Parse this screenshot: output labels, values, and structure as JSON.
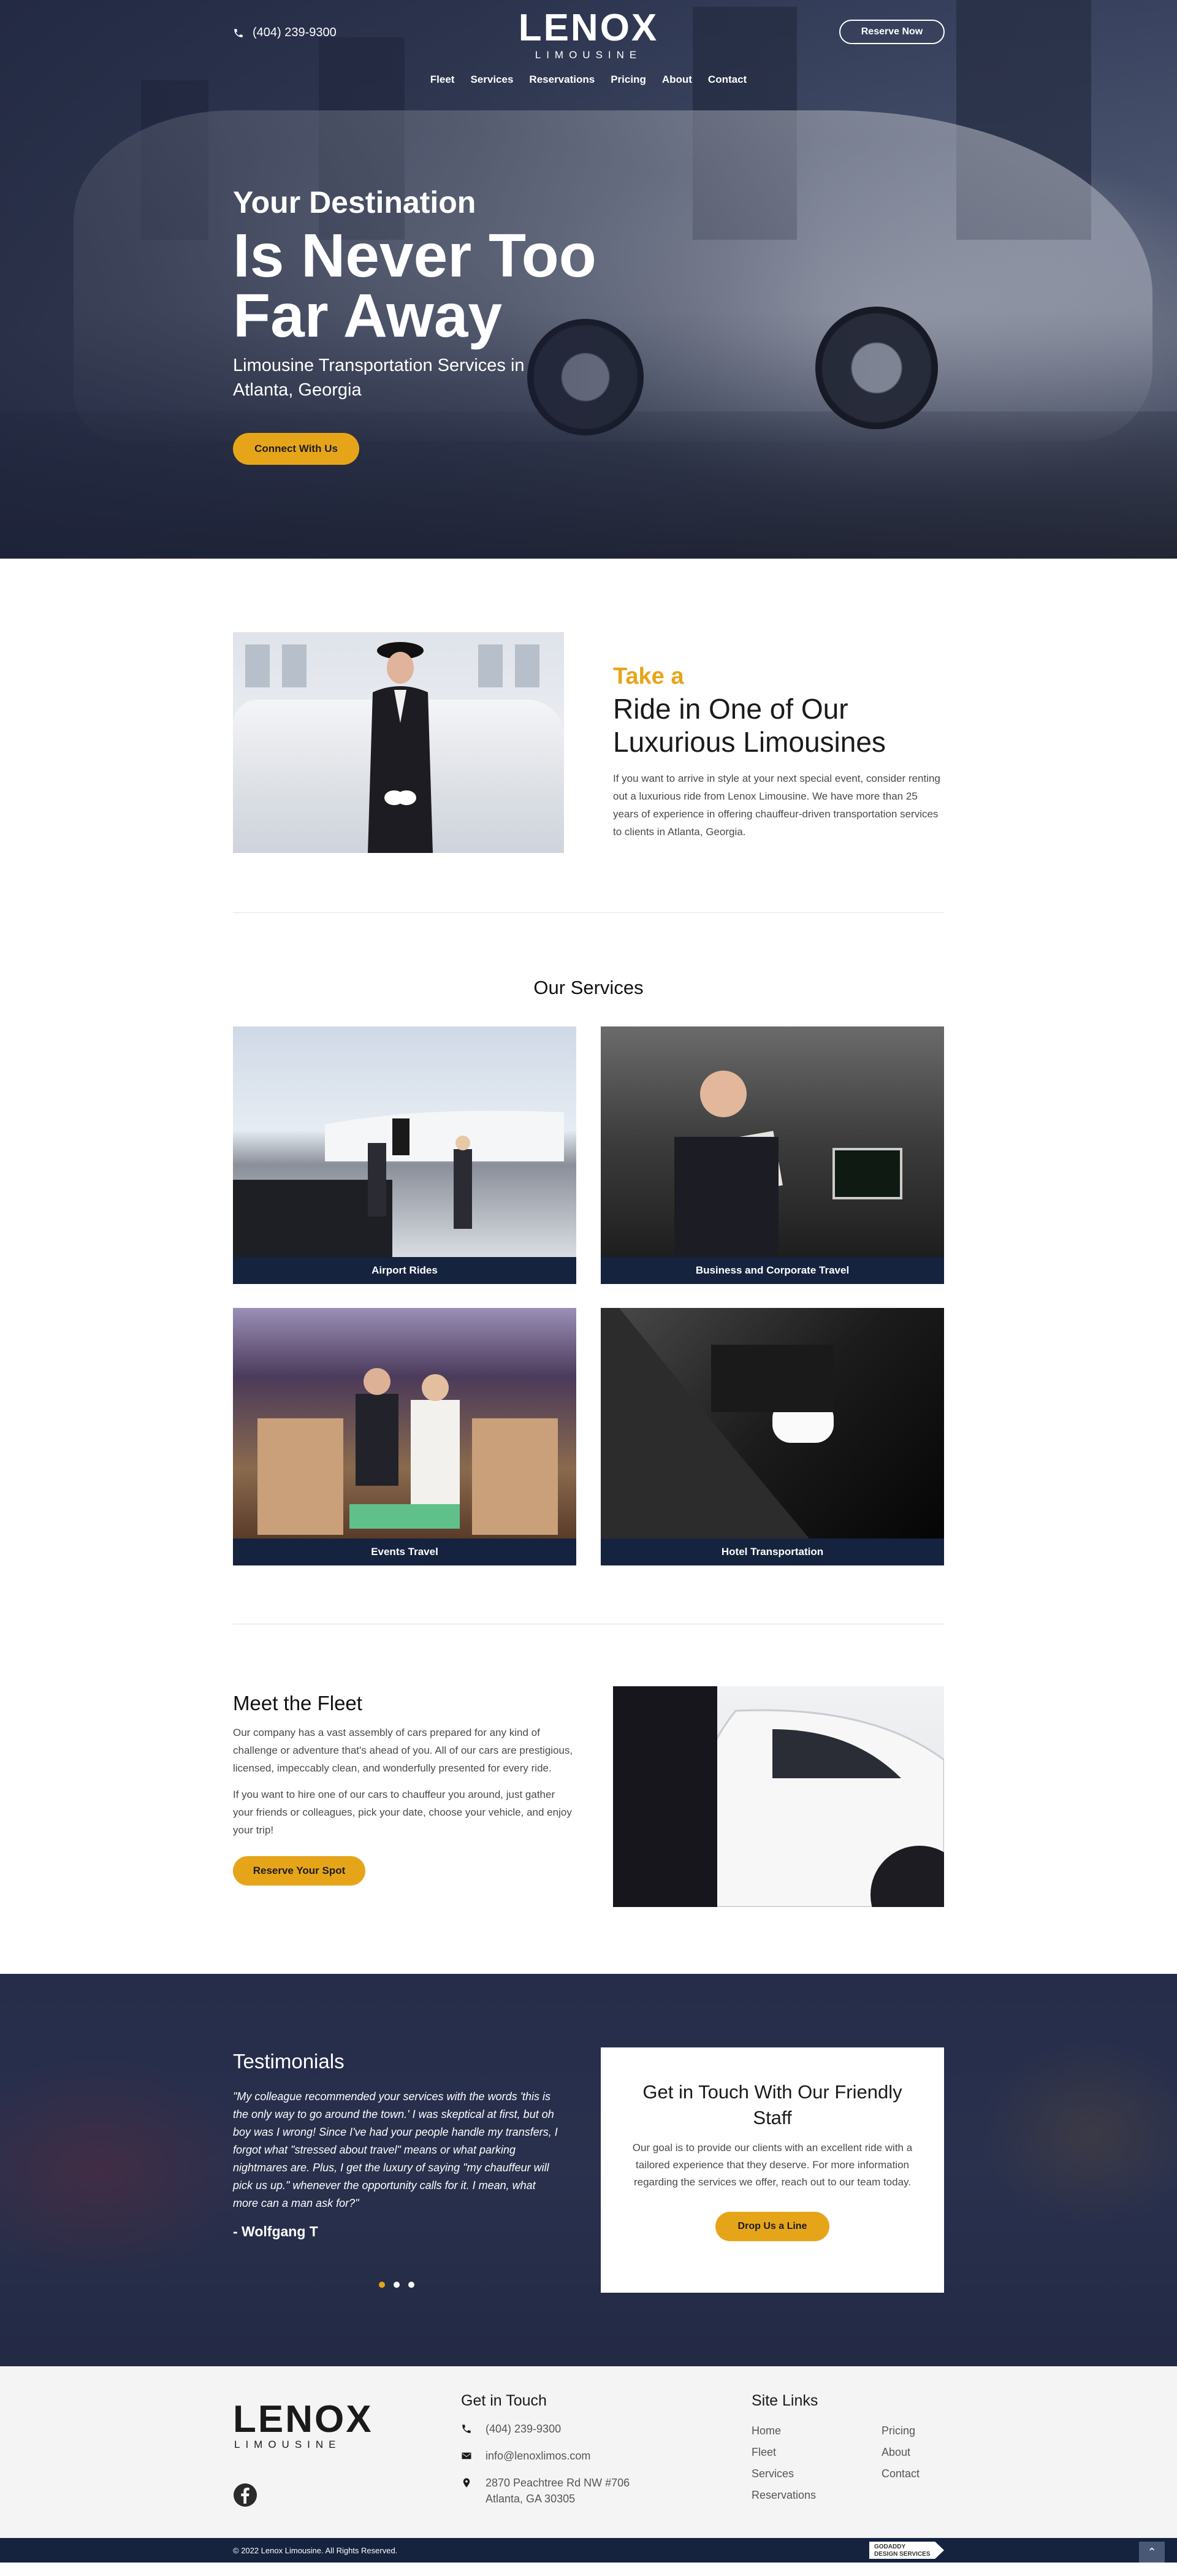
{
  "header": {
    "phone": "(404) 239-9300",
    "logo_word": "LENOX",
    "logo_sub": "LIMOUSINE",
    "reserve_label": "Reserve Now",
    "nav": [
      "Fleet",
      "Services",
      "Reservations",
      "Pricing",
      "About",
      "Contact"
    ]
  },
  "hero": {
    "line1": "Your Destination",
    "line2a": "Is Never Too",
    "line2b": "Far Away",
    "subtitle": "Limousine Transportation Services in Atlanta, Georgia",
    "cta": "Connect With Us"
  },
  "ride": {
    "kicker": "Take a",
    "title": "Ride in One of Our Luxurious Limousines",
    "body": "If you want to arrive in style at your next special event, consider renting out a luxurious ride from Lenox Limousine. We have more than 25 years of experience in offering chauffeur-driven transportation services to clients in Atlanta, Georgia."
  },
  "services": {
    "title": "Our Services",
    "items": [
      {
        "caption": "Airport Rides"
      },
      {
        "caption": "Business and Corporate Travel"
      },
      {
        "caption": "Events Travel"
      },
      {
        "caption": "Hotel Transportation"
      }
    ]
  },
  "fleet": {
    "title": "Meet the Fleet",
    "p1": "Our company has a vast assembly of cars prepared for any kind of challenge or adventure that's ahead of you. All of our cars are prestigious, licensed, impeccably clean, and wonderfully presented for every ride.",
    "p2": "If you want to hire one of our cars to chauffeur you around, just gather your friends or colleagues, pick your date, choose your vehicle, and enjoy your trip!",
    "cta": "Reserve Your Spot"
  },
  "testimonials": {
    "title": "Testimonials",
    "quote": "\"My colleague recommended your services with the words 'this is the only way to go around the town.' I was skeptical at first, but oh boy was I wrong! Since I've had your people handle my transfers, I forgot what \"stressed about travel\" means or what parking nightmares are. Plus, I get the luxury of saying \"my chauffeur will pick us up.\" whenever the opportunity calls for it. I mean, what more can a man ask for?\"",
    "author": "- Wolfgang T",
    "slide_active": 1,
    "slide_count": 3
  },
  "contact_card": {
    "title": "Get in Touch With Our Friendly Staff",
    "body": "Our goal is to provide our clients with an excellent ride with a tailored experience that they deserve. For more information regarding the services we offer, reach out to our team today.",
    "cta": "Drop Us a Line"
  },
  "footer": {
    "get_in_touch_title": "Get in Touch",
    "phone": "(404) 239-9300",
    "email": "info@lenoxlimos.com",
    "address_line1": "2870 Peachtree Rd NW #706",
    "address_line2": "Atlanta, GA 30305",
    "site_links_title": "Site Links",
    "links": [
      "Home",
      "Pricing",
      "Fleet",
      "About",
      "Services",
      "Contact",
      "Reservations"
    ],
    "copyright": "© 2022 Lenox Limousine. All Rights Reserved.",
    "badge_line1": "GODADDY",
    "badge_line2": "DESIGN SERVICES"
  },
  "colors": {
    "accent": "#e6a519",
    "navy": "#15233f",
    "footer_bg": "#f4f4f4"
  },
  "icons": [
    "phone-icon",
    "email-icon",
    "location-icon",
    "facebook-icon",
    "arrow-up-icon"
  ]
}
